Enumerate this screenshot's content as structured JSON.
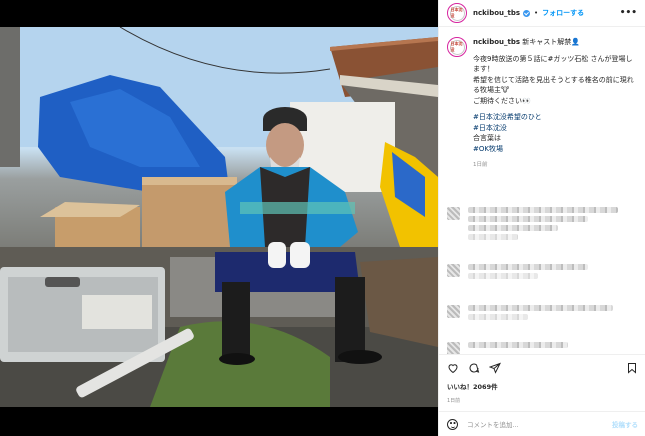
{
  "post": {
    "username": "nckibou_tbs",
    "separator": "•",
    "follow_label": "フォローする",
    "more_label": "•••",
    "avatar_text": "日本沈没",
    "caption": {
      "username": "nckibou_tbs",
      "first": "新キャスト解禁👤",
      "lines": [
        "今夜9時放送の第５話に#ガッツ石松 さんが登場します！",
        "希望を信じて活路を見出そうとする椎名の前に現れる牧場主🐮",
        "ご期待ください👀"
      ],
      "tags": [
        "#日本沈没希望のひと",
        "#日本沈没",
        "合言葉は",
        "#OK牧場"
      ]
    },
    "caption_time": "1日前",
    "likes": "いいね！2069件",
    "date": "1日前",
    "comment_placeholder": "コメントを追加...",
    "post_button": "投稿する"
  },
  "icons": [
    "heart-icon",
    "comment-icon",
    "share-icon",
    "bookmark-icon",
    "emoji-icon",
    "verified-icon"
  ],
  "colors": {
    "link": "#0095f6",
    "hashtag": "#00376b",
    "muted": "#8e8e8e"
  }
}
